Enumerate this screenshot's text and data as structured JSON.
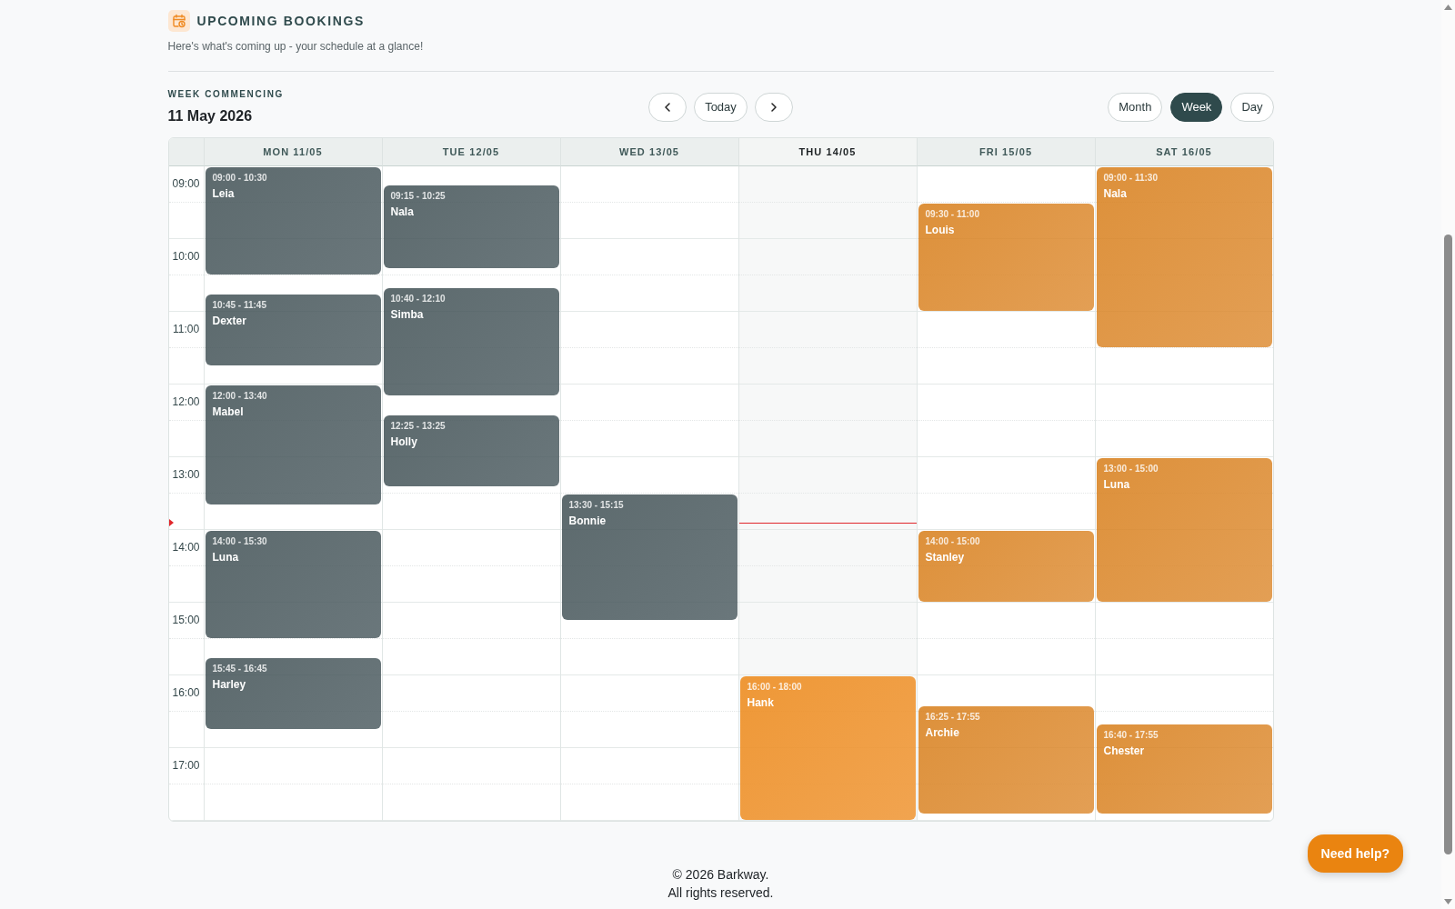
{
  "header": {
    "title": "UPCOMING BOOKINGS",
    "subtitle": "Here's what's coming up - your schedule at a glance!"
  },
  "toolbar": {
    "week_label": "WEEK COMMENCING",
    "week_date": "11 May 2026",
    "today_button": "Today",
    "views": [
      {
        "label": "Month",
        "selected": false
      },
      {
        "label": "Week",
        "selected": true
      },
      {
        "label": "Day",
        "selected": false
      }
    ]
  },
  "calendar": {
    "hours": [
      {
        "label": "09:00",
        "now": false
      },
      {
        "label": "10:00",
        "now": false
      },
      {
        "label": "11:00",
        "now": false
      },
      {
        "label": "12:00",
        "now": false
      },
      {
        "label": "13:00",
        "now": true
      },
      {
        "label": "14:00",
        "now": false
      },
      {
        "label": "15:00",
        "now": false
      },
      {
        "label": "16:00",
        "now": false
      },
      {
        "label": "17:00",
        "now": false
      }
    ],
    "days": [
      {
        "label": "MON 11/05",
        "today": false,
        "events": [
          {
            "time": "09:00 - 10:30",
            "name": "Leia",
            "kind": "past"
          },
          {
            "time": "10:45 - 11:45",
            "name": "Dexter",
            "kind": "past"
          },
          {
            "time": "12:00 - 13:40",
            "name": "Mabel",
            "kind": "past"
          },
          {
            "time": "14:00 - 15:30",
            "name": "Luna",
            "kind": "past"
          },
          {
            "time": "15:45 - 16:45",
            "name": "Harley",
            "kind": "past"
          }
        ]
      },
      {
        "label": "TUE 12/05",
        "today": false,
        "events": [
          {
            "time": "09:15 - 10:25",
            "name": "Nala",
            "kind": "past"
          },
          {
            "time": "10:40 - 12:10",
            "name": "Simba",
            "kind": "past"
          },
          {
            "time": "12:25 - 13:25",
            "name": "Holly",
            "kind": "past"
          }
        ]
      },
      {
        "label": "WED 13/05",
        "today": false,
        "events": [
          {
            "time": "13:30 - 15:15",
            "name": "Bonnie",
            "kind": "past"
          }
        ]
      },
      {
        "label": "THU 14/05",
        "today": true,
        "events": [
          {
            "time": "16:00 - 18:00",
            "name": "Hank",
            "kind": "today"
          }
        ]
      },
      {
        "label": "FRI 15/05",
        "today": false,
        "events": [
          {
            "time": "09:30 - 11:00",
            "name": "Louis",
            "kind": "upcoming"
          },
          {
            "time": "14:00 - 15:00",
            "name": "Stanley",
            "kind": "upcoming"
          },
          {
            "time": "16:25 - 17:55",
            "name": "Archie",
            "kind": "upcoming"
          }
        ]
      },
      {
        "label": "SAT 16/05",
        "today": false,
        "events": [
          {
            "time": "09:00 - 11:30",
            "name": "Nala",
            "kind": "upcoming"
          },
          {
            "time": "13:00 - 15:00",
            "name": "Luna",
            "kind": "upcoming"
          },
          {
            "time": "16:40 - 17:55",
            "name": "Chester",
            "kind": "upcoming"
          }
        ]
      }
    ]
  },
  "footer": {
    "lines": [
      "© 2026 Barkway.",
      "All rights reserved."
    ]
  },
  "help_button": "Need help?"
}
